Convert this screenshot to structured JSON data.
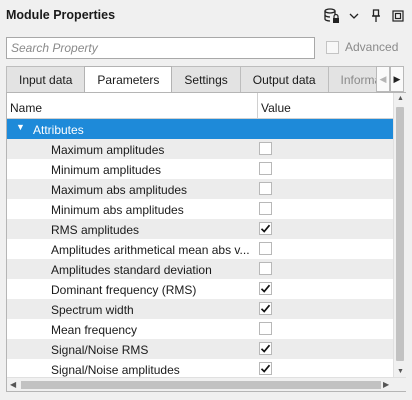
{
  "panel": {
    "title": "Module Properties"
  },
  "toolbar": {
    "icons": [
      "database-icon",
      "chevron-down-icon",
      "pin-icon",
      "window-icon"
    ]
  },
  "search": {
    "placeholder": "Search Property",
    "value": ""
  },
  "advanced": {
    "label": "Advanced",
    "checked": false,
    "enabled": false
  },
  "tabs": [
    {
      "label": "Input data",
      "active": false
    },
    {
      "label": "Parameters",
      "active": true
    },
    {
      "label": "Settings",
      "active": false
    },
    {
      "label": "Output data",
      "active": false
    },
    {
      "label": "Informa",
      "active": false
    }
  ],
  "tree": {
    "columns": [
      "Name",
      "Value"
    ],
    "group": "Attributes",
    "rows": [
      {
        "label": "Maximum amplitudes",
        "checked": false
      },
      {
        "label": "Minimum amplitudes",
        "checked": false
      },
      {
        "label": "Maximum abs amplitudes",
        "checked": false
      },
      {
        "label": "Minimum abs amplitudes",
        "checked": false
      },
      {
        "label": "RMS amplitudes",
        "checked": true
      },
      {
        "label": "Amplitudes arithmetical mean abs v...",
        "checked": false
      },
      {
        "label": "Amplitudes standard deviation",
        "checked": false
      },
      {
        "label": "Dominant frequency (RMS)",
        "checked": true
      },
      {
        "label": "Spectrum width",
        "checked": true
      },
      {
        "label": "Mean frequency",
        "checked": false
      },
      {
        "label": "Signal/Noise RMS",
        "checked": true
      },
      {
        "label": "Signal/Noise amplitudes",
        "checked": true
      }
    ]
  },
  "colors": {
    "selection": "#1e8ad9",
    "alt_row": "#ececec"
  }
}
